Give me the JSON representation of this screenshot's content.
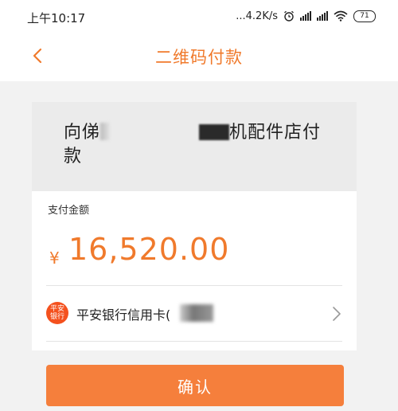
{
  "status_bar": {
    "time": "上午10:17",
    "network_speed": "...4.2K/s",
    "battery": "71"
  },
  "header": {
    "title": "二维码付款",
    "back_icon": "chevron-left-icon"
  },
  "merchant": {
    "name_start": "向俤",
    "name_end": "机配件店付款"
  },
  "payment": {
    "amount_label": "支付金额",
    "currency_symbol": "¥",
    "amount": "16,520.00"
  },
  "card": {
    "bank_logo_line1": "平安",
    "bank_logo_line2": "银行",
    "name": "平安银行信用卡(",
    "chevron_icon": "chevron-right-icon"
  },
  "actions": {
    "confirm_label": "确认"
  },
  "colors": {
    "accent": "#f07a2c",
    "button": "#f57f3c",
    "bank_logo": "#f4511e"
  }
}
